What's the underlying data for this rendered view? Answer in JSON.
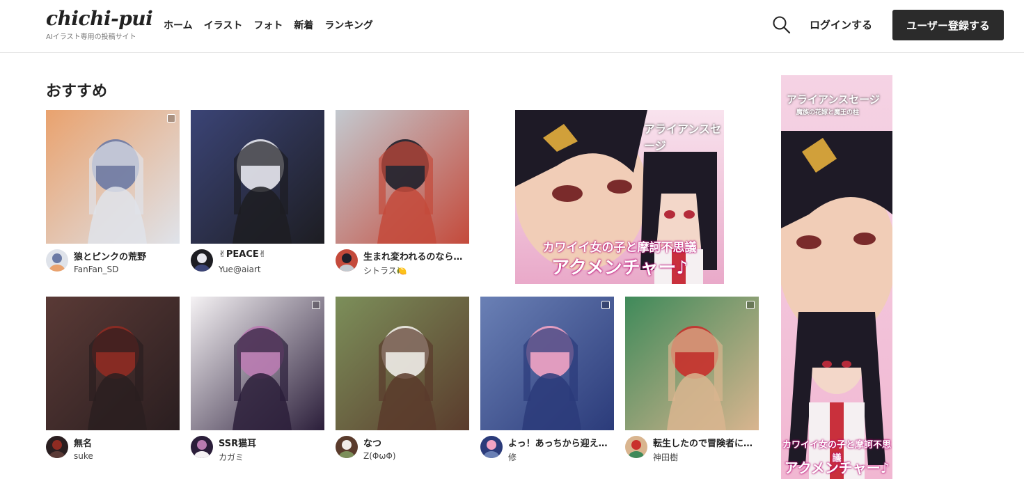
{
  "header": {
    "logo": "chichi-pui",
    "tagline": "AIイラスト専用の投稿サイト",
    "nav": [
      "ホーム",
      "イラスト",
      "フォト",
      "新着",
      "ランキング"
    ],
    "login_label": "ログインする",
    "register_label": "ユーザー登録する"
  },
  "section": {
    "title": "おすすめ"
  },
  "works": [
    {
      "title": "狼とピンクの荒野",
      "user": "FanFan_SD",
      "palette": [
        "#e9a26e",
        "#6b7aa5",
        "#dfe3ea"
      ]
    },
    {
      "title": "✌PEACE✌",
      "user": "Yue@aiart",
      "palette": [
        "#3b4476",
        "#e8e8ee",
        "#1d1d22"
      ]
    },
    {
      "title": "生まれ変われるのなら…",
      "user": "シトラス🍋",
      "palette": [
        "#c3c9cf",
        "#1f1f2a",
        "#c44a3b"
      ]
    },
    {
      "title": "無名",
      "user": "suke",
      "palette": [
        "#5a3a36",
        "#8f2b22",
        "#2a1e20"
      ]
    },
    {
      "title": "SSR猫耳",
      "user": "カガミ",
      "palette": [
        "#f5f2f4",
        "#b97bb1",
        "#2b1e3a"
      ]
    },
    {
      "title": "なつ",
      "user": "Z(ΦωΦ)",
      "palette": [
        "#7c8f5a",
        "#f0ece8",
        "#5a3b2c"
      ]
    },
    {
      "title": "よっ！あっちから迎えに来たよ",
      "user": "修",
      "palette": [
        "#6a80b5",
        "#f2a3c3",
        "#2b3b7a"
      ]
    },
    {
      "title": "転生したので冒険者になりました",
      "user": "神田樹",
      "palette": [
        "#3f8a5a",
        "#c9302c",
        "#d9b58f"
      ]
    }
  ],
  "ads": {
    "brand": "アライアンスセージ",
    "brand_sub": "魔族の花嫁と魔王の柱",
    "caption_line1": "カワイイ女の子と摩訶不思議",
    "caption_line2": "アクメンチャー♪"
  },
  "colors": {
    "accent": "#2b2b2b",
    "ad_pink": "#f3c6dd"
  },
  "icons": {
    "search": "search-icon"
  }
}
